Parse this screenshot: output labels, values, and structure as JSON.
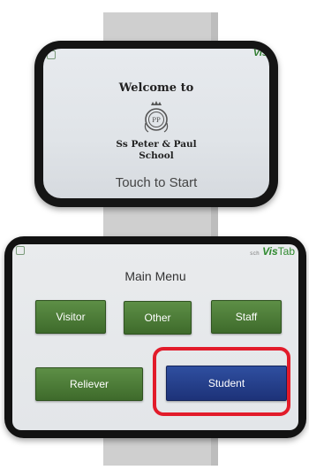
{
  "welcome_screen": {
    "welcome_text": "Welcome to",
    "crest_monogram": "PP",
    "school_line1": "Ss Peter & Paul",
    "school_line2": "School",
    "touch_text": "Touch to Start",
    "brand": "Vis"
  },
  "menu_screen": {
    "brand_prefix": "sch",
    "brand_vis": "Vis",
    "brand_tab": "Tab",
    "title": "Main Menu",
    "buttons": {
      "visitor": "Visitor",
      "other": "Other",
      "staff": "Staff",
      "reliever": "Reliever",
      "student": "Student"
    }
  },
  "colors": {
    "button_green": "#4c7c36",
    "button_blue": "#24398a",
    "highlight_red": "#e21b2a",
    "brand_green": "#2f8a2f"
  }
}
